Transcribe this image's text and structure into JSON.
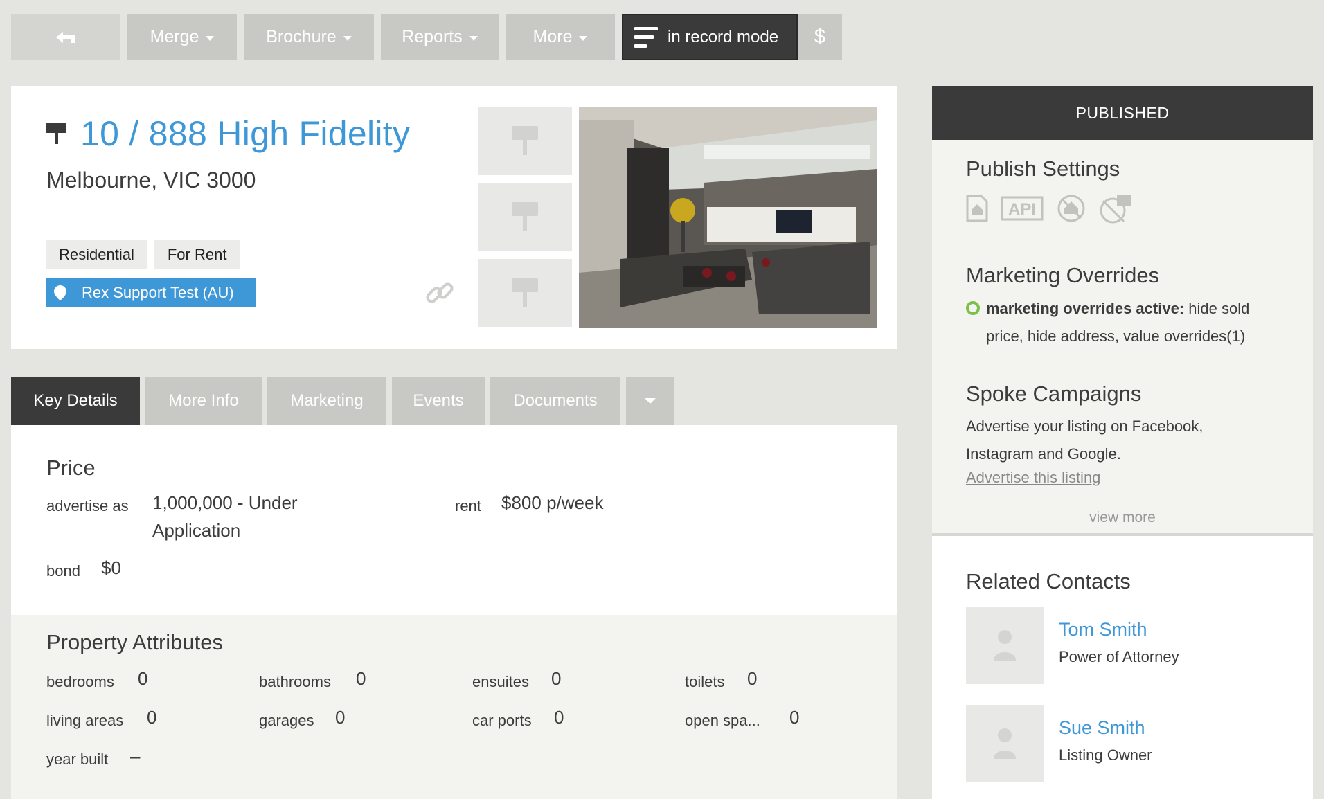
{
  "toolbar": {
    "merge": "Merge",
    "brochure": "Brochure",
    "reports": "Reports",
    "more": "More",
    "record_mode": "in record mode",
    "dollar": "$"
  },
  "listing": {
    "title": "10 / 888 High Fidelity",
    "suburb": "Melbourne, VIC 3000",
    "tags": [
      "Residential",
      "For Rent"
    ],
    "account": "Rex Support Test (AU)"
  },
  "tabs": [
    "Key Details",
    "More Info",
    "Marketing",
    "Events",
    "Documents"
  ],
  "price": {
    "title": "Price",
    "advertise_label": "advertise as",
    "advertise_value_1": "1,000,000 - Under",
    "advertise_value_2": "Application",
    "rent_label": "rent",
    "rent_value": "$800 p/week",
    "bond_label": "bond",
    "bond_value": "$0"
  },
  "attributes": {
    "title": "Property Attributes",
    "items": [
      {
        "label": "bedrooms",
        "value": "0"
      },
      {
        "label": "bathrooms",
        "value": "0"
      },
      {
        "label": "ensuites",
        "value": "0"
      },
      {
        "label": "toilets",
        "value": "0"
      },
      {
        "label": "living areas",
        "value": "0"
      },
      {
        "label": "garages",
        "value": "0"
      },
      {
        "label": "car ports",
        "value": "0"
      },
      {
        "label": "open spa...",
        "value": "0"
      },
      {
        "label": "year built",
        "value": "–"
      }
    ]
  },
  "panel": {
    "status": "PUBLISHED",
    "publish_title": "Publish Settings",
    "api_label": "API",
    "overrides_title": "Marketing Overrides",
    "overrides_bold": "marketing overrides active:",
    "overrides_text": " hide sold price, hide address, value overrides(1)",
    "spoke_title": "Spoke Campaigns",
    "spoke_text": "Advertise your listing on Facebook, Instagram and Google.",
    "spoke_link": "Advertise this listing",
    "view_more": "view more"
  },
  "contacts": {
    "title": "Related Contacts",
    "items": [
      {
        "name": "Tom Smith",
        "role": "Power of Attorney"
      },
      {
        "name": "Sue Smith",
        "role": "Listing Owner"
      }
    ]
  },
  "colors": {
    "accent": "#3e97d6",
    "dark": "#3a3a3a",
    "button_grey": "#c8c8c4",
    "status_green": "#7cc04a"
  }
}
